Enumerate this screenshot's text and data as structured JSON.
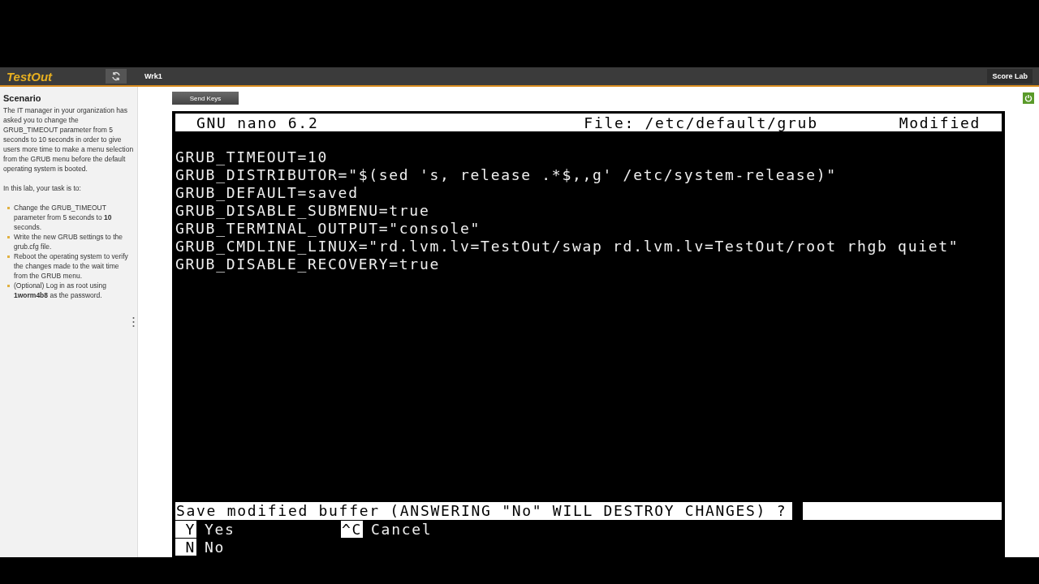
{
  "header": {
    "logo": "TestOut",
    "tab": "Wrk1",
    "score_button": "Score Lab"
  },
  "scenario": {
    "title": "Scenario",
    "intro": "The IT manager in your organization has asked you to change the GRUB_TIMEOUT parameter from 5 seconds to 10 seconds in order to give users more time to make a menu selection from the GRUB menu before the default operating system is booted.",
    "task_lead": "In this lab, your task is to:",
    "tasks": [
      "Change the GRUB_TIMEOUT parameter from 5 seconds to **10** seconds.",
      "Write the new GRUB settings to the grub.cfg file.",
      "Reboot the operating system to verify the changes made to the wait time from the GRUB menu.",
      "(Optional) Log in as root using **1worm4b8** as the password."
    ]
  },
  "toolbar": {
    "send_keys": "Send Keys"
  },
  "terminal": {
    "app": "GNU nano 6.2",
    "file": "File: /etc/default/grub",
    "status": "Modified",
    "lines": [
      "GRUB_TIMEOUT=10",
      "GRUB_DISTRIBUTOR=\"$(sed 's, release .*$,,g' /etc/system-release)\"",
      "GRUB_DEFAULT=saved",
      "GRUB_DISABLE_SUBMENU=true",
      "GRUB_TERMINAL_OUTPUT=\"console\"",
      "GRUB_CMDLINE_LINUX=\"rd.lvm.lv=TestOut/swap rd.lvm.lv=TestOut/root rhgb quiet\"",
      "GRUB_DISABLE_RECOVERY=true"
    ],
    "prompt": "Save modified buffer (ANSWERING \"No\" WILL DESTROY CHANGES) ?",
    "shortcuts": [
      {
        "key": "Y",
        "label": "Yes"
      },
      {
        "key": "N",
        "label": "No"
      },
      {
        "key": "^C",
        "label": "Cancel"
      }
    ]
  }
}
